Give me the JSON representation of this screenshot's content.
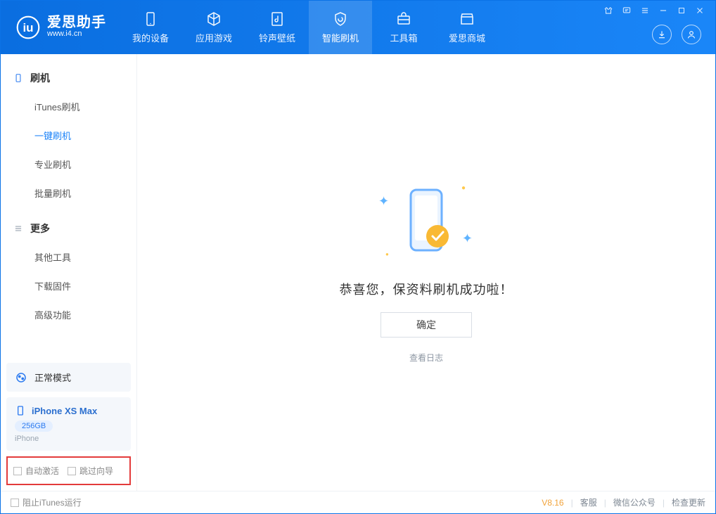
{
  "app": {
    "name_cn": "爱思助手",
    "url": "www.i4.cn"
  },
  "tabs": [
    {
      "label": "我的设备"
    },
    {
      "label": "应用游戏"
    },
    {
      "label": "铃声壁纸"
    },
    {
      "label": "智能刷机"
    },
    {
      "label": "工具箱"
    },
    {
      "label": "爱思商城"
    }
  ],
  "sidebar": {
    "section1": {
      "title": "刷机",
      "items": [
        "iTunes刷机",
        "一键刷机",
        "专业刷机",
        "批量刷机"
      ]
    },
    "section2": {
      "title": "更多",
      "items": [
        "其他工具",
        "下载固件",
        "高级功能"
      ]
    }
  },
  "mode": {
    "label": "正常模式"
  },
  "device": {
    "name": "iPhone XS Max",
    "capacity": "256GB",
    "type": "iPhone"
  },
  "options": {
    "auto_activate": "自动激活",
    "skip_guide": "跳过向导"
  },
  "main": {
    "message": "恭喜您，保资料刷机成功啦！",
    "ok": "确定",
    "view_log": "查看日志"
  },
  "footer": {
    "block_itunes": "阻止iTunes运行",
    "version": "V8.16",
    "support": "客服",
    "wechat": "微信公众号",
    "check_update": "检查更新"
  }
}
